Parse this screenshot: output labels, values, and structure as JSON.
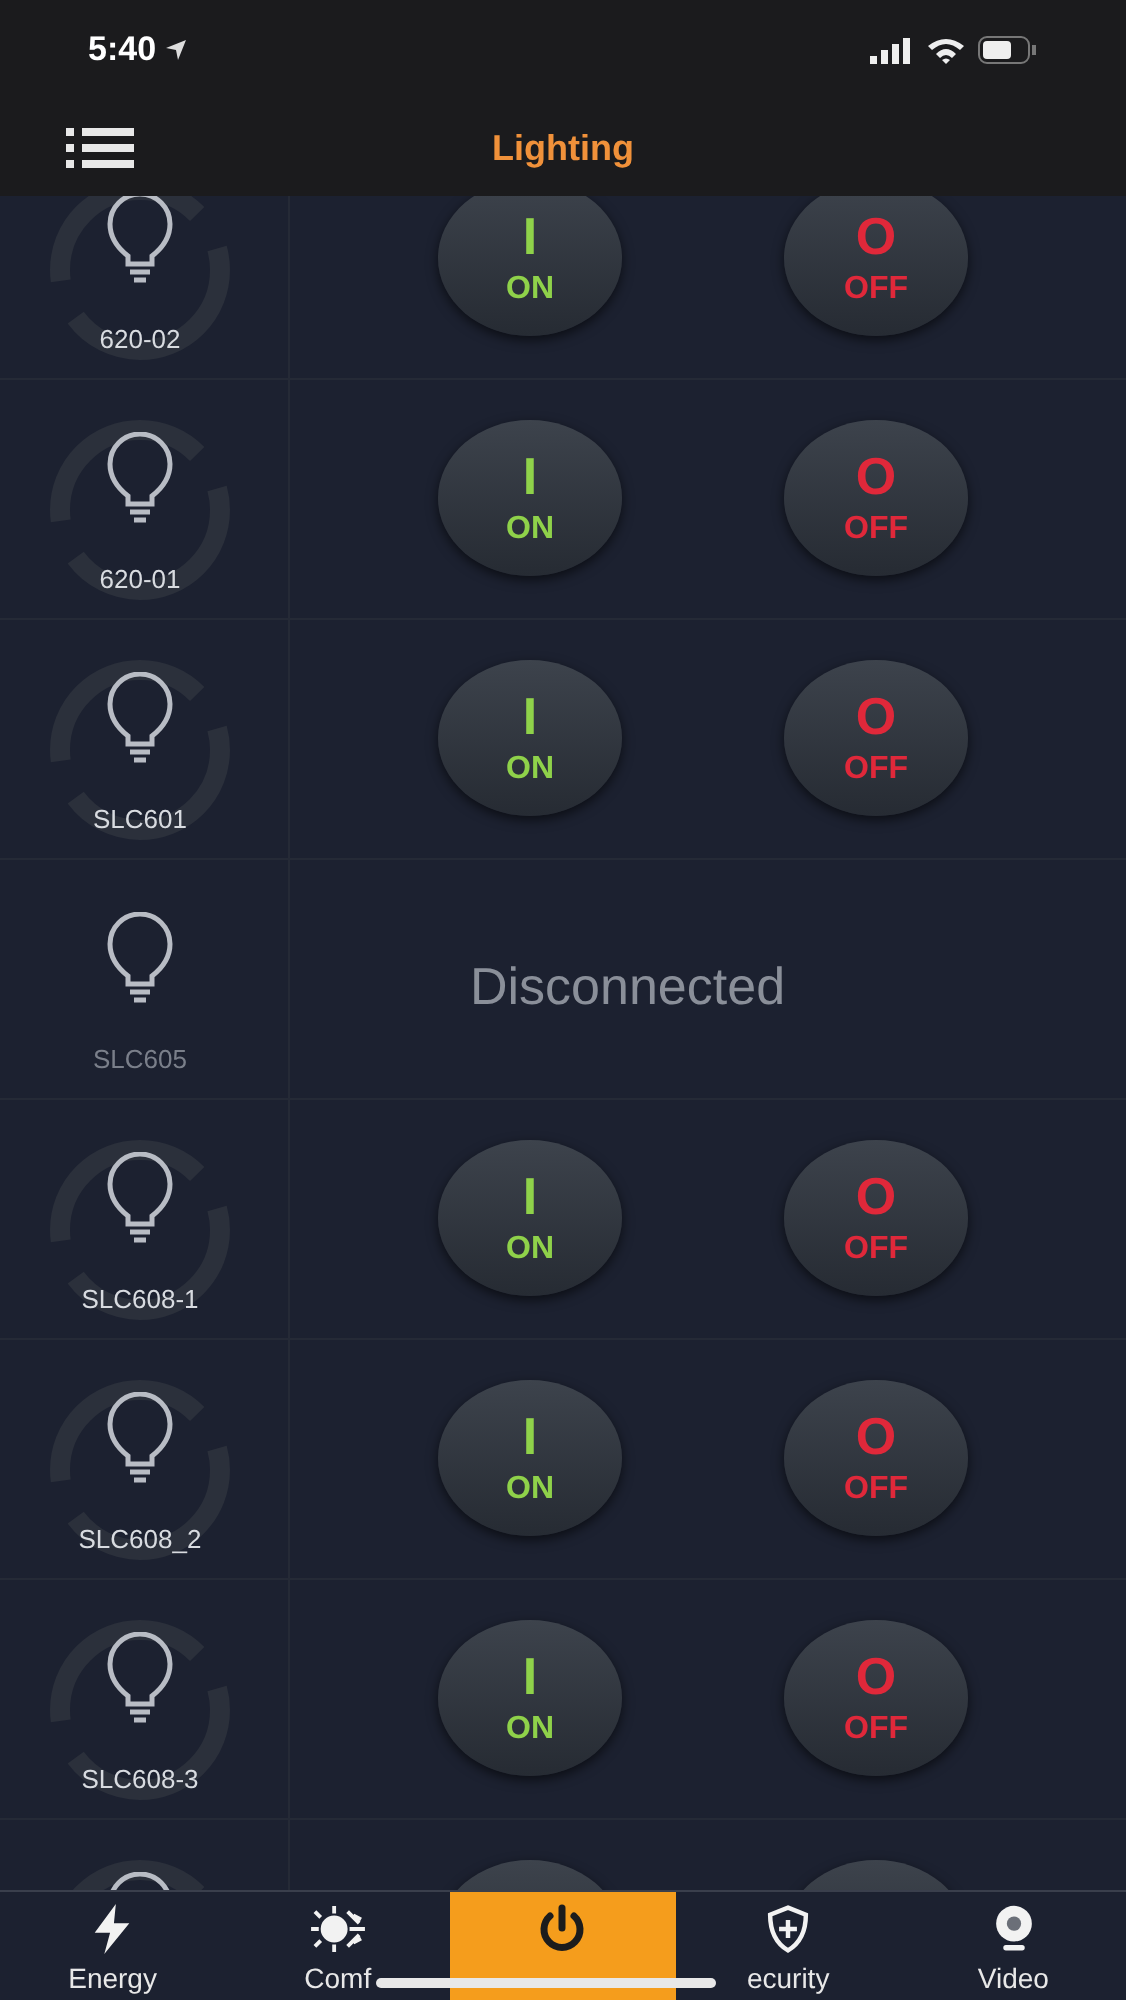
{
  "status_bar": {
    "time": "5:40"
  },
  "header": {
    "title": "Lighting"
  },
  "devices": [
    {
      "kind": "switch",
      "name": "620-02",
      "on_label": "ON",
      "off_label": "OFF",
      "on_glyph": "I",
      "off_glyph": "O"
    },
    {
      "kind": "switch",
      "name": "620-01",
      "on_label": "ON",
      "off_label": "OFF",
      "on_glyph": "I",
      "off_glyph": "O"
    },
    {
      "kind": "switch",
      "name": "SLC601",
      "on_label": "ON",
      "off_label": "OFF",
      "on_glyph": "I",
      "off_glyph": "O"
    },
    {
      "kind": "disconnected",
      "name": "SLC605",
      "status": "Disconnected"
    },
    {
      "kind": "switch",
      "name": "SLC608-1",
      "on_label": "ON",
      "off_label": "OFF",
      "on_glyph": "I",
      "off_glyph": "O"
    },
    {
      "kind": "switch",
      "name": "SLC608_2",
      "on_label": "ON",
      "off_label": "OFF",
      "on_glyph": "I",
      "off_glyph": "O"
    },
    {
      "kind": "switch",
      "name": "SLC608-3",
      "on_label": "ON",
      "off_label": "OFF",
      "on_glyph": "I",
      "off_glyph": "O"
    },
    {
      "kind": "cut"
    }
  ],
  "tabs": [
    {
      "kind": "energy",
      "label": "Energy",
      "selected": false
    },
    {
      "kind": "comfort",
      "label": "Comf",
      "selected": false
    },
    {
      "kind": "lighting",
      "selected": true
    },
    {
      "kind": "security",
      "label": "ecurity",
      "selected": false
    },
    {
      "kind": "video",
      "label": "Video",
      "selected": false
    }
  ]
}
